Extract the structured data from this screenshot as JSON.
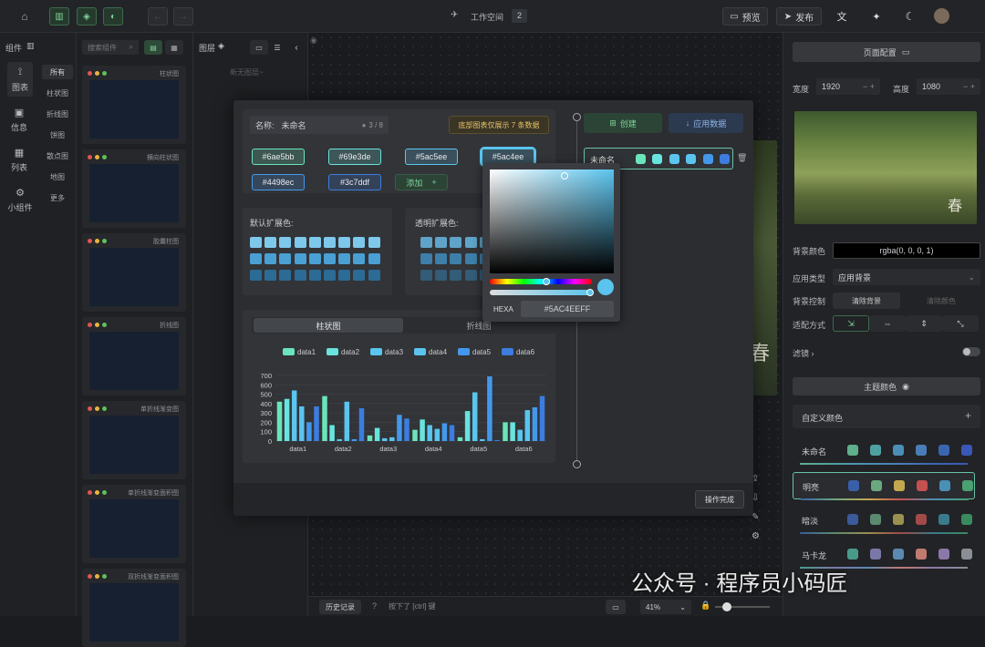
{
  "topbar": {
    "workspace_label": "工作空间",
    "workspace_num": "2",
    "preview": "预览",
    "publish": "发布"
  },
  "leftnav": {
    "groups_label": "组件",
    "items": [
      "图表",
      "信息",
      "列表",
      "小组件"
    ],
    "sub_items": [
      "所有",
      "柱状图",
      "折线图",
      "饼图",
      "散点图",
      "地图",
      "更多"
    ],
    "search_placeholder": "搜索组件"
  },
  "components": [
    "柱状图",
    "横向柱状图",
    "胶囊柱图",
    "折线图",
    "单折线渐变图",
    "单折线渐变面积图",
    "双折线渐变面积图"
  ],
  "layers": {
    "title": "图层",
    "placeholder": "新无图层~"
  },
  "dialog": {
    "name_label": "名称:",
    "name_value": "未命名",
    "name_count": "3 / 8",
    "hint": "底部图表仅展示 7 条数据",
    "create": "创建",
    "apply": "应用数据",
    "colors": [
      "#6ae5bb",
      "#69e3de",
      "#5ac5ee",
      "#5ac4ee",
      "#4498ec",
      "#3c7ddf"
    ],
    "add": "添加",
    "default_ext": "默认扩展色:",
    "transparent_ext": "透明扩展色:",
    "tab_bar": "柱状图",
    "tab_line": "折线图",
    "list_name": "未命名",
    "done": "操作完成",
    "picker": {
      "label": "HEXA",
      "value": "#5AC4EEFF"
    }
  },
  "chart_data": {
    "type": "bar",
    "categories": [
      "data1",
      "data2",
      "data3",
      "data4",
      "data5",
      "data6"
    ],
    "ylim": [
      0,
      700
    ],
    "yticks": [
      "700",
      "600",
      "500",
      "400",
      "300",
      "200",
      "100",
      "0"
    ],
    "series": [
      {
        "name": "data1",
        "color": "#6ae5bb",
        "values": [
          420,
          480,
          60,
          120,
          40,
          200
        ]
      },
      {
        "name": "data2",
        "color": "#69e3de",
        "values": [
          450,
          170,
          140,
          230,
          320,
          200
        ]
      },
      {
        "name": "data3",
        "color": "#5ac5ee",
        "values": [
          540,
          20,
          30,
          170,
          520,
          120
        ]
      },
      {
        "name": "data4",
        "color": "#5ac4ee",
        "values": [
          370,
          420,
          40,
          130,
          20,
          330
        ]
      },
      {
        "name": "data5",
        "color": "#4498ec",
        "values": [
          200,
          20,
          280,
          190,
          690,
          360
        ]
      },
      {
        "name": "data6",
        "color": "#3c7ddf",
        "values": [
          370,
          350,
          240,
          170,
          10,
          480
        ]
      }
    ]
  },
  "right": {
    "page_config": "页面配置",
    "width_label": "宽度",
    "width": "1920",
    "height_label": "高度",
    "height": "1080",
    "bg_color_label": "背景颜色",
    "bg_color": "rgba(0, 0, 0, 1)",
    "apply_type_label": "应用类型",
    "apply_type": "应用背景",
    "bg_control_label": "背景控制",
    "clear_bg": "清除背景",
    "clear_color": "清除颜色",
    "fit_label": "适配方式",
    "filter_label": "滤镜",
    "theme_title": "主题颜色",
    "custom_color": "自定义颜色",
    "themes": [
      {
        "name": "未命名",
        "colors": [
          "#5fae8c",
          "#4fa0a0",
          "#4a8fb5",
          "#4a7db8",
          "#3a66b0",
          "#3a58b8"
        ]
      },
      {
        "name": "明亮",
        "colors": [
          "#3a5fa8",
          "#6aa87e",
          "#c4a84e",
          "#c45050",
          "#4a8fb5",
          "#4aa070"
        ]
      },
      {
        "name": "暗淡",
        "colors": [
          "#3a5a9a",
          "#5a8a70",
          "#9a9050",
          "#a04a4a",
          "#3a7a8a",
          "#3a8a60"
        ]
      },
      {
        "name": "马卡龙",
        "colors": [
          "#4a9a8a",
          "#7a78a8",
          "#5a8ab0",
          "#c07a70",
          "#8a78a8",
          "#8a8f96"
        ]
      }
    ]
  },
  "status": {
    "history": "历史记录",
    "hint": "按下了 [ctrl] 键",
    "zoom": "41%"
  },
  "watermark": "公众号 · 程序员小码匠"
}
